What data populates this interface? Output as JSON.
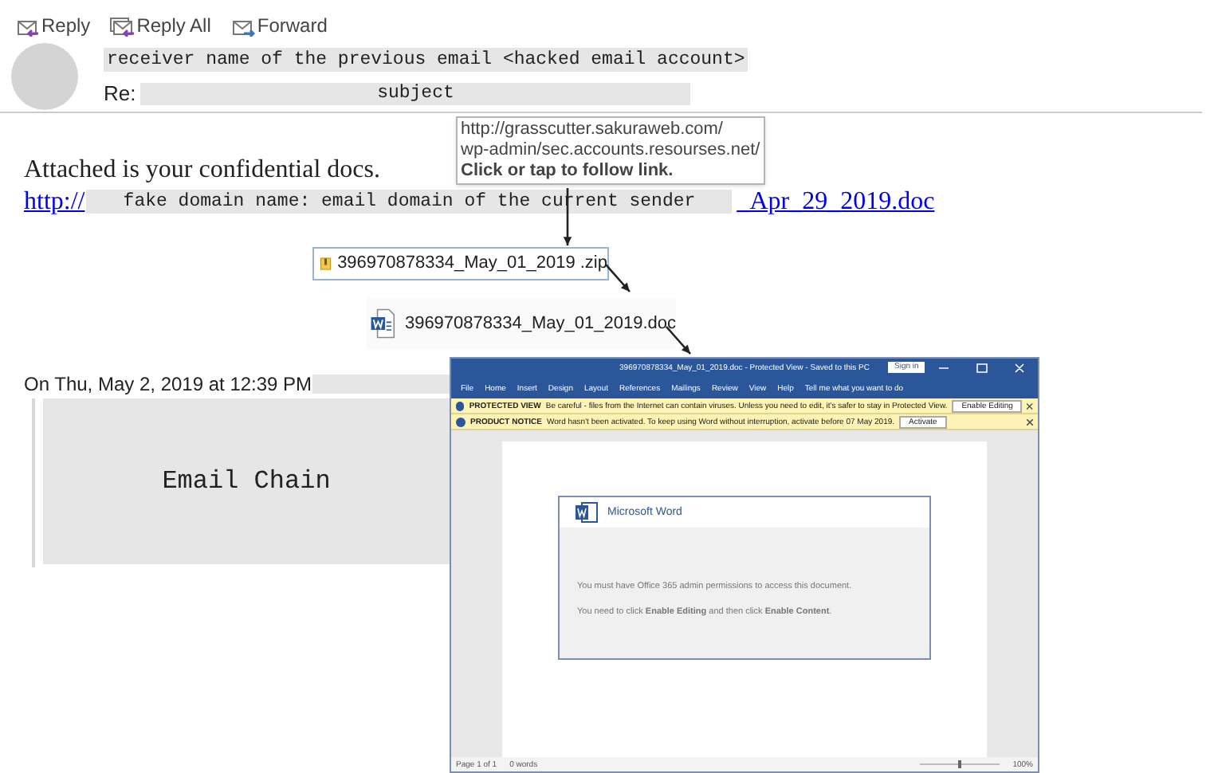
{
  "toolbar": [
    {
      "kind": "reply",
      "label": "Reply"
    },
    {
      "kind": "reply_all",
      "label": "Reply All"
    },
    {
      "kind": "forward",
      "label": "Forward"
    }
  ],
  "email": {
    "sender": "receiver name of the previous email <hacked email account>",
    "subject_prefix": "Re:",
    "subject": "subject",
    "body": "Attached is your confidential docs.",
    "link": {
      "prefix": "http://",
      "masked": "fake domain name: email domain of the current sender",
      "suffix": "_Apr_29_2019.doc"
    },
    "quote_header": "On Thu, May 2, 2019 at 12:39 PM",
    "quoted": "Email Chain"
  },
  "tooltip": {
    "url_lines": [
      "http://grasscutter.sakuraweb.com/",
      "wp-admin/sec.accounts.resourses.net/"
    ],
    "hint": "Click or tap to follow link."
  },
  "attachments": [
    {
      "kind": "zip",
      "name": "396970878334_May_01_2019 .zip"
    },
    {
      "kind": "doc",
      "name": "396970878334_May_01_2019.doc"
    }
  ],
  "word_window": {
    "title": "396970878334_May_01_2019.doc - Protected View - Saved to this PC",
    "sign_in": "Sign in",
    "tabs": [
      "File",
      "Home",
      "Insert",
      "Design",
      "Layout",
      "References",
      "Mailings",
      "Review",
      "View",
      "Help"
    ],
    "tell_me": "Tell me what you want to do",
    "bars": [
      {
        "label": "PROTECTED VIEW",
        "message": "Be careful - files from the Internet can contain viruses. Unless you need to edit, it's safer to stay in Protected View.",
        "button": "Enable Editing"
      },
      {
        "label": "PRODUCT NOTICE",
        "message": "Word hasn't been activated. To keep using Word without interruption, activate before 07 May 2019.",
        "button": "Activate"
      }
    ],
    "dialog": {
      "title": "Microsoft Word",
      "lines": [
        "You must have Office 365 admin permissions to access this document.",
        "You need to click **Enable Editing** and then click **Enable Content**."
      ]
    },
    "status": {
      "page": "Page 1 of 1",
      "words": "0 words",
      "zoom": "100%"
    }
  }
}
